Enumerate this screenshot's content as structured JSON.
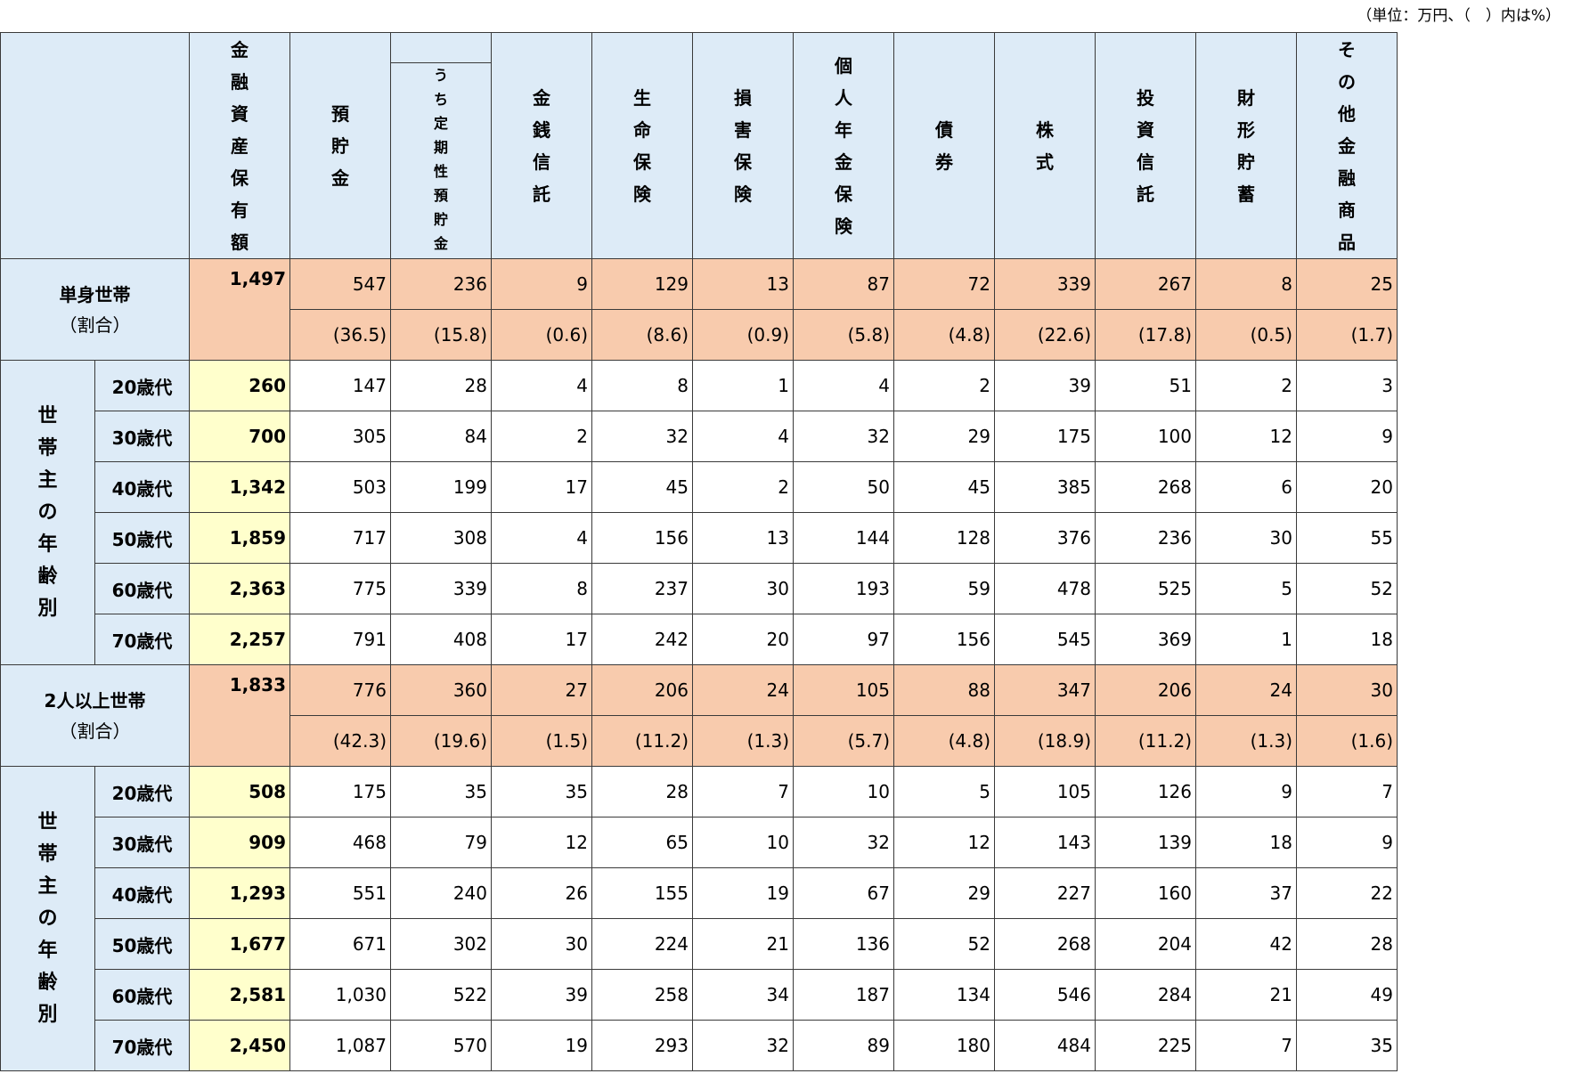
{
  "unit_note": "（単位：万円、（　）内は%）",
  "columns": {
    "total": "金融資産保有額",
    "deposits": "預貯金",
    "time_deposits": "うち定期性預貯金",
    "money_trust": "金銭信託",
    "life_insurance": "生命保険",
    "nonlife_insurance": "損害保険",
    "pension_insurance": "個人年金保険",
    "bonds": "債　券",
    "stocks": "株　式",
    "investment_trust": "投資信託",
    "savings_plan": "財形貯蓄",
    "other": "その他金融商品"
  },
  "single": {
    "label": "単身世帯",
    "ratio_label": "（割合）",
    "side_label": "世帯主の年齢別",
    "summary": {
      "total": "1,497",
      "values": [
        "547",
        "236",
        "9",
        "129",
        "13",
        "87",
        "72",
        "339",
        "267",
        "8",
        "25"
      ],
      "ratios": [
        "(36.5)",
        "(15.8)",
        "(0.6)",
        "(8.6)",
        "(0.9)",
        "(5.8)",
        "(4.8)",
        "(22.6)",
        "(17.8)",
        "(0.5)",
        "(1.7)"
      ]
    },
    "ages": [
      {
        "age": "20歳代",
        "total": "260",
        "values": [
          "147",
          "28",
          "4",
          "8",
          "1",
          "4",
          "2",
          "39",
          "51",
          "2",
          "3"
        ]
      },
      {
        "age": "30歳代",
        "total": "700",
        "values": [
          "305",
          "84",
          "2",
          "32",
          "4",
          "32",
          "29",
          "175",
          "100",
          "12",
          "9"
        ]
      },
      {
        "age": "40歳代",
        "total": "1,342",
        "values": [
          "503",
          "199",
          "17",
          "45",
          "2",
          "50",
          "45",
          "385",
          "268",
          "6",
          "20"
        ]
      },
      {
        "age": "50歳代",
        "total": "1,859",
        "values": [
          "717",
          "308",
          "4",
          "156",
          "13",
          "144",
          "128",
          "376",
          "236",
          "30",
          "55"
        ]
      },
      {
        "age": "60歳代",
        "total": "2,363",
        "values": [
          "775",
          "339",
          "8",
          "237",
          "30",
          "193",
          "59",
          "478",
          "525",
          "5",
          "52"
        ]
      },
      {
        "age": "70歳代",
        "total": "2,257",
        "values": [
          "791",
          "408",
          "17",
          "242",
          "20",
          "97",
          "156",
          "545",
          "369",
          "1",
          "18"
        ]
      }
    ]
  },
  "multi": {
    "label": "2人以上世帯",
    "ratio_label": "（割合）",
    "side_label": "世帯主の年齢別",
    "summary": {
      "total": "1,833",
      "values": [
        "776",
        "360",
        "27",
        "206",
        "24",
        "105",
        "88",
        "347",
        "206",
        "24",
        "30"
      ],
      "ratios": [
        "(42.3)",
        "(19.6)",
        "(1.5)",
        "(11.2)",
        "(1.3)",
        "(5.7)",
        "(4.8)",
        "(18.9)",
        "(11.2)",
        "(1.3)",
        "(1.6)"
      ]
    },
    "ages": [
      {
        "age": "20歳代",
        "total": "508",
        "values": [
          "175",
          "35",
          "35",
          "28",
          "7",
          "10",
          "5",
          "105",
          "126",
          "9",
          "7"
        ]
      },
      {
        "age": "30歳代",
        "total": "909",
        "values": [
          "468",
          "79",
          "12",
          "65",
          "10",
          "32",
          "12",
          "143",
          "139",
          "18",
          "9"
        ]
      },
      {
        "age": "40歳代",
        "total": "1,293",
        "values": [
          "551",
          "240",
          "26",
          "155",
          "19",
          "67",
          "29",
          "227",
          "160",
          "37",
          "22"
        ]
      },
      {
        "age": "50歳代",
        "total": "1,677",
        "values": [
          "671",
          "302",
          "30",
          "224",
          "21",
          "136",
          "52",
          "268",
          "204",
          "42",
          "28"
        ]
      },
      {
        "age": "60歳代",
        "total": "2,581",
        "values": [
          "1,030",
          "522",
          "39",
          "258",
          "34",
          "187",
          "134",
          "546",
          "284",
          "21",
          "49"
        ]
      },
      {
        "age": "70歳代",
        "total": "2,450",
        "values": [
          "1,087",
          "570",
          "19",
          "293",
          "32",
          "89",
          "180",
          "484",
          "225",
          "7",
          "35"
        ]
      }
    ]
  }
}
